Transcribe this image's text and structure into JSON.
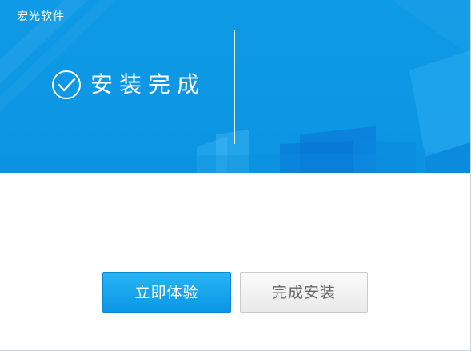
{
  "window": {
    "title": "宏光软件"
  },
  "banner": {
    "status_icon": "check-circle-icon",
    "status_text": "安装完成"
  },
  "actions": {
    "primary_label": "立即体验",
    "secondary_label": "完成安装"
  },
  "colors": {
    "banner_blue": "#0e9ae6",
    "primary_button": "#14a3ec",
    "secondary_button": "#efefef",
    "secondary_text": "#666666"
  }
}
